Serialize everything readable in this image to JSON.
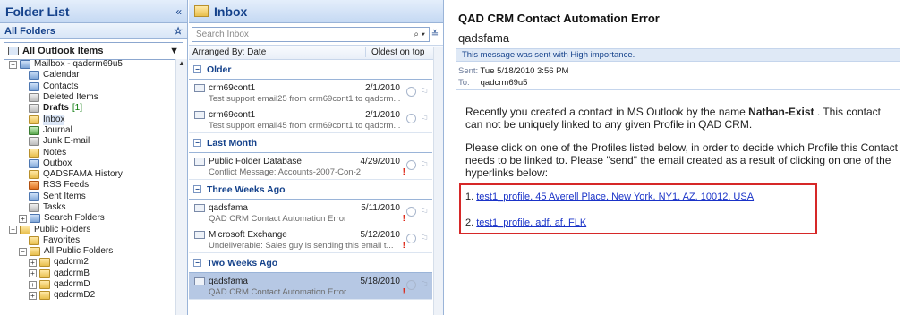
{
  "folder_pane": {
    "title": "Folder List",
    "collapse_glyph": "«",
    "subheader": "All Folders",
    "subheader_glyph": "☆",
    "selector_label": "All Outlook Items",
    "tree": [
      {
        "label": "Mailbox - qadcrm69u5",
        "indent": 0,
        "exp": "⊟",
        "icon": "mailbox"
      },
      {
        "label": "Calendar",
        "indent": 2,
        "icon": "calendar"
      },
      {
        "label": "Contacts",
        "indent": 2,
        "icon": "contacts"
      },
      {
        "label": "Deleted Items",
        "indent": 2,
        "icon": "deleted"
      },
      {
        "label": "Drafts",
        "indent": 2,
        "icon": "drafts",
        "bold": true,
        "count": "[1]"
      },
      {
        "label": "Inbox",
        "indent": 2,
        "icon": "inbox",
        "selected": true
      },
      {
        "label": "Journal",
        "indent": 2,
        "icon": "journal"
      },
      {
        "label": "Junk E-mail",
        "indent": 2,
        "icon": "junk"
      },
      {
        "label": "Notes",
        "indent": 2,
        "icon": "notes"
      },
      {
        "label": "Outbox",
        "indent": 2,
        "icon": "outbox"
      },
      {
        "label": "QADSFAMA History",
        "indent": 2,
        "icon": "folder"
      },
      {
        "label": "RSS Feeds",
        "indent": 2,
        "icon": "rss"
      },
      {
        "label": "Sent Items",
        "indent": 2,
        "icon": "sent"
      },
      {
        "label": "Tasks",
        "indent": 2,
        "icon": "tasks"
      },
      {
        "label": "Search Folders",
        "indent": 1,
        "exp": "⊞",
        "icon": "search-folder"
      },
      {
        "label": "Public Folders",
        "indent": 0,
        "exp": "⊟",
        "icon": "public"
      },
      {
        "label": "Favorites",
        "indent": 2,
        "icon": "folder"
      },
      {
        "label": "All Public Folders",
        "indent": 1,
        "exp": "⊟",
        "icon": "folder"
      },
      {
        "label": "qadcrm2",
        "indent": 2,
        "exp": "⊞",
        "icon": "folder"
      },
      {
        "label": "qadcrmB",
        "indent": 2,
        "exp": "⊞",
        "icon": "folder"
      },
      {
        "label": "qadcrmD",
        "indent": 2,
        "exp": "⊞",
        "icon": "folder"
      },
      {
        "label": "qadcrmD2",
        "indent": 2,
        "exp": "⊞",
        "icon": "folder"
      }
    ]
  },
  "list_pane": {
    "title": "Inbox",
    "search_placeholder": "Search Inbox",
    "search_glyph": "⌕ ▾",
    "expand_glyph": "≚",
    "arranged_by": "Arranged By: Date",
    "sort_order": "Oldest on top",
    "groups": [
      {
        "label": "Older",
        "messages": [
          {
            "sender": "crm69cont1",
            "date": "2/1/2010",
            "preview": "Test support email25 from crm69cont1 to qadcrm...",
            "important": false
          },
          {
            "sender": "crm69cont1",
            "date": "2/1/2010",
            "preview": "Test support email45 from crm69cont1 to qadcrm...",
            "important": false
          }
        ]
      },
      {
        "label": "Last Month",
        "messages": [
          {
            "sender": "Public Folder Database",
            "date": "4/29/2010",
            "preview": "Conflict Message: Accounts-2007-Con-2",
            "important": true
          }
        ]
      },
      {
        "label": "Three Weeks Ago",
        "messages": [
          {
            "sender": "qadsfama",
            "date": "5/11/2010",
            "preview": "QAD CRM Contact Automation Error",
            "important": true
          },
          {
            "sender": "Microsoft Exchange",
            "date": "5/12/2010",
            "preview": "Undeliverable: Sales guy is sending this email t...",
            "important": true
          }
        ]
      },
      {
        "label": "Two Weeks Ago",
        "messages": [
          {
            "sender": "qadsfama",
            "date": "5/18/2010",
            "preview": "QAD CRM Contact Automation Error",
            "important": true,
            "selected": true
          }
        ]
      }
    ]
  },
  "reading_pane": {
    "subject": "QAD CRM Contact Automation Error",
    "from": "qadsfama",
    "importance_note": "This message was sent with High importance.",
    "sent_label": "Sent:",
    "sent_value": "Tue 5/18/2010 3:56 PM",
    "to_label": "To:",
    "to_value": "qadcrm69u5",
    "body_p1_a": "Recently you created a contact in MS Outlook by the name ",
    "body_p1_name": "Nathan-Exist",
    "body_p1_b": " . This contact can not be uniquely linked to any given Profile in QAD CRM.",
    "body_p2": "Please click on one of the Profiles listed below, in order to decide which Profile this Contact needs to be linked to. Please \"send\" the email created as a result of clicking on one of the hyperlinks below:",
    "links": [
      {
        "num": "1.",
        "text": "test1_profile, 45 Averell Place, New York, NY1, AZ, 10012, USA"
      },
      {
        "num": "2.",
        "text": "test1_profile, adf, af, FLK"
      }
    ]
  }
}
